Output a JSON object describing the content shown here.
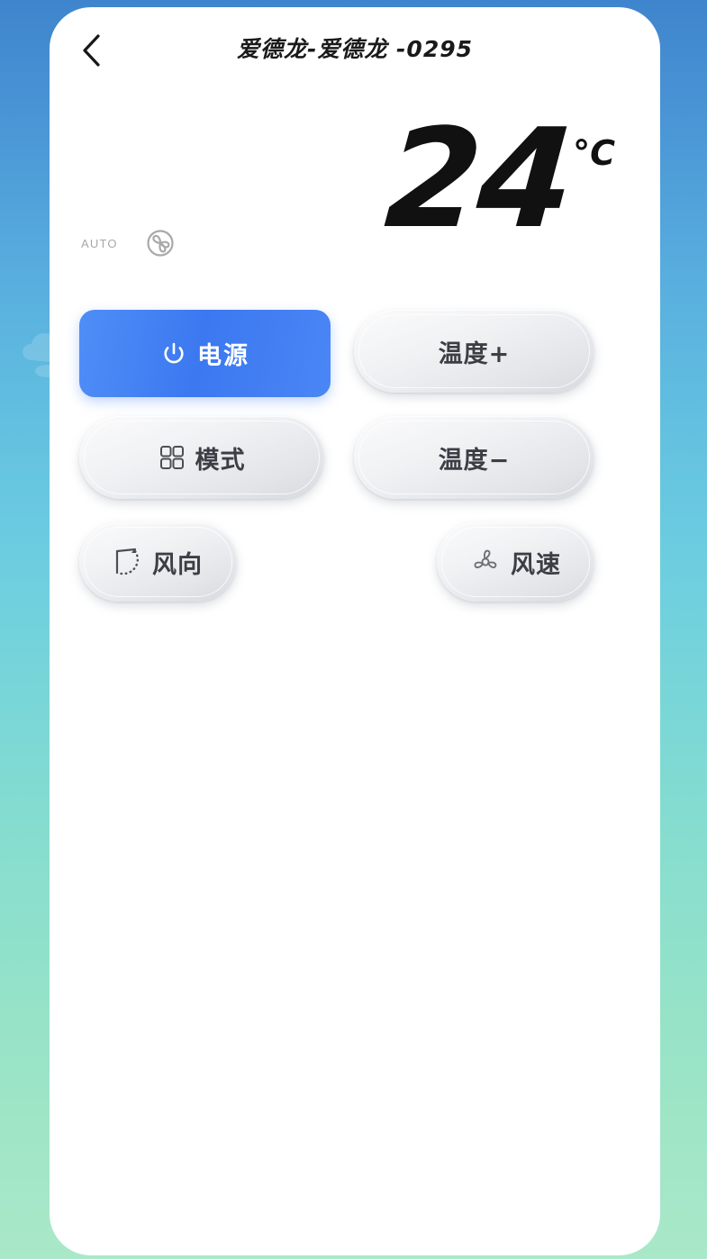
{
  "header": {
    "back_icon": "chevron-left-icon",
    "title": "爱德龙-爱德龙 -0295"
  },
  "display": {
    "temperature": "24",
    "unit": "°C",
    "mode_label": "AUTO",
    "mode_icon": "auto-swirl-icon"
  },
  "controls": {
    "power": {
      "label": "电源",
      "icon": "power-icon",
      "state": "active",
      "accent": "#3c78f0"
    },
    "mode": {
      "label": "模式",
      "icon": "grid-icon"
    },
    "temp_up": {
      "label": "温度+",
      "icon": ""
    },
    "temp_down": {
      "label": "温度−",
      "icon": ""
    },
    "swing": {
      "label": "风向",
      "icon": "swing-louver-icon"
    },
    "fan_speed": {
      "label": "风速",
      "icon": "fan-blade-icon"
    }
  },
  "theme": {
    "bg_top": "#3f85cd",
    "bg_bottom": "#a9e8c9",
    "card_bg": "#ffffff",
    "pill_text": "#3b3f45",
    "muted_text": "#a8a8a8"
  }
}
